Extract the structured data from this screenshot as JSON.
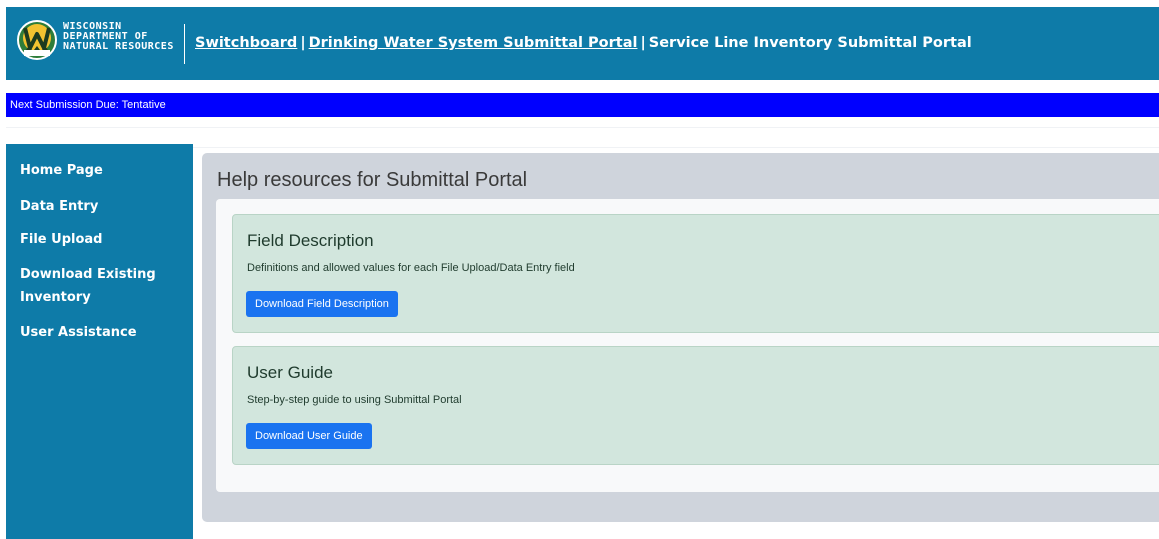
{
  "header": {
    "logo_lines": [
      "WISCONSIN",
      "DEPARTMENT OF",
      "NATURAL RESOURCES"
    ],
    "nav_links": [
      "Switchboard",
      "Drinking Water System Submittal Portal"
    ],
    "separator": "|",
    "current_page": "Service Line Inventory Submittal Portal"
  },
  "due_bar": {
    "text": "Next Submission Due: Tentative"
  },
  "sidebar": {
    "items": [
      {
        "label": "Home Page"
      },
      {
        "label": "Data Entry"
      },
      {
        "label": "File Upload"
      },
      {
        "label": "Download Existing"
      },
      {
        "label": "Inventory"
      },
      {
        "label": "User Assistance"
      }
    ]
  },
  "main": {
    "title": "Help resources for Submittal Portal",
    "cards": [
      {
        "heading": "Field Description",
        "description": "Definitions and allowed values for each File Upload/Data Entry field",
        "button": "Download Field Description"
      },
      {
        "heading": "User Guide",
        "description": "Step-by-step guide to using Submittal Portal",
        "button": "Download User Guide"
      }
    ]
  },
  "colors": {
    "header_bg": "#0e7ba8",
    "due_bar_bg": "#0000ff",
    "card_bg": "#d2e6dd",
    "button_bg": "#1a73f0"
  }
}
